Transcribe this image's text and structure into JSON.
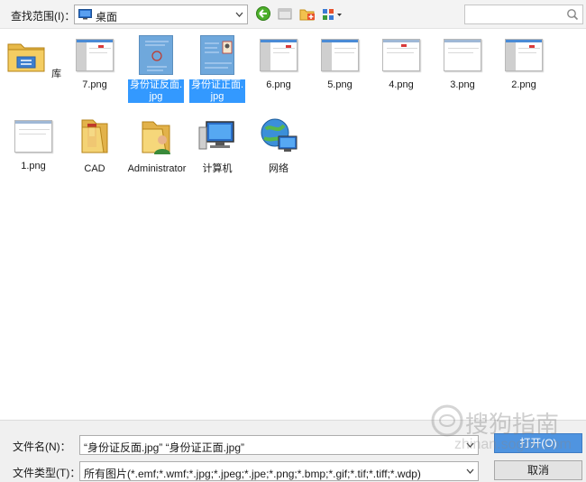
{
  "toolbar": {
    "lookin_label": "查找范围(I)：",
    "location": "桌面",
    "search_placeholder": ""
  },
  "files": [
    {
      "name": "库",
      "kind": "library-icon",
      "selected": false
    },
    {
      "name": "7.png",
      "kind": "png-thumbnail-icon",
      "selected": false
    },
    {
      "name": "身份证反面.jpg",
      "kind": "id-card-back-thumbnail-icon",
      "selected": true
    },
    {
      "name": "身份证正面.jpg",
      "kind": "id-card-front-thumbnail-icon",
      "selected": true
    },
    {
      "name": "6.png",
      "kind": "png-thumbnail-icon",
      "selected": false
    },
    {
      "name": "5.png",
      "kind": "png-thumbnail-icon",
      "selected": false
    },
    {
      "name": "4.png",
      "kind": "png-thumbnail-icon",
      "selected": false
    },
    {
      "name": "3.png",
      "kind": "png-thumbnail-icon",
      "selected": false
    },
    {
      "name": "2.png",
      "kind": "png-thumbnail-icon",
      "selected": false
    },
    {
      "name": "1.png",
      "kind": "png-thumbnail-icon",
      "selected": false
    },
    {
      "name": "CAD",
      "kind": "folder-icon",
      "selected": false
    },
    {
      "name": "Administrator",
      "kind": "user-folder-icon",
      "selected": false
    },
    {
      "name": "计算机",
      "kind": "computer-icon",
      "selected": false
    },
    {
      "name": "网络",
      "kind": "network-icon",
      "selected": false
    }
  ],
  "bottom": {
    "filename_label": "文件名(N)：",
    "filename_value": "“身份证反面.jpg” “身份证正面.jpg”",
    "filetype_label": "文件类型(T)：",
    "filetype_value": "所有图片(*.emf;*.wmf;*.jpg;*.jpeg;*.jpe;*.png;*.bmp;*.gif;*.tif;*.tiff;*.wdp)",
    "open_button": "打开(O)",
    "cancel_button": "取消"
  },
  "watermark": {
    "text": "搜狗指南",
    "subtext": "zhinan.sogou.com"
  },
  "colors": {
    "selection": "#3399ff",
    "primary_button": "#4f94e0",
    "toolbar_bg": "#f3f3f3"
  }
}
